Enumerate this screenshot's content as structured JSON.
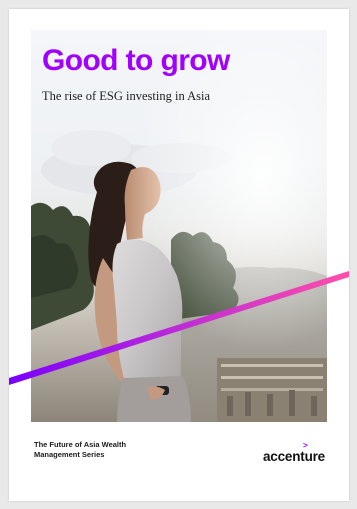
{
  "cover": {
    "title": "Good to grow",
    "subtitle": "The rise of ESG investing in Asia",
    "series": "The Future of Asia Wealth\nManagement Series",
    "logo_text": "accenture",
    "logo_mark": ">"
  },
  "colors": {
    "title": "#a100ff",
    "stripe_start": "#7a00ff",
    "stripe_end": "#ff4fa8",
    "text": "#1b1b1b"
  }
}
